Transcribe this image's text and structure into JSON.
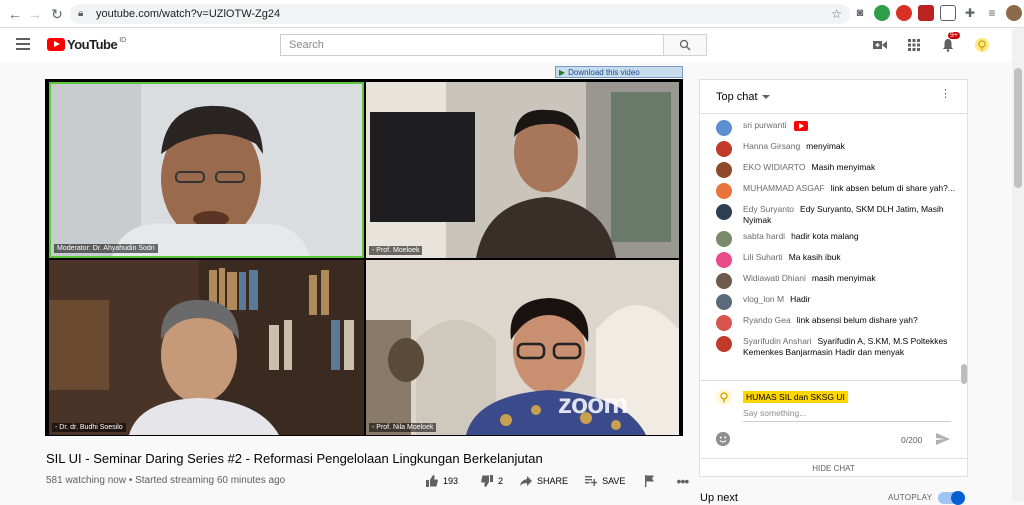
{
  "browser": {
    "url": "youtube.com/watch?v=UZlOTW-Zg24"
  },
  "header": {
    "logo_text": "YouTube",
    "country_code": "ID",
    "search_placeholder": "Search",
    "notification_count": "9+"
  },
  "video": {
    "download_label": "Download this video",
    "zoom_watermark": "zoom",
    "tiles": [
      {
        "label": "Moderator: Dr. Ahyahudin Sodri"
      },
      {
        "label": "- Prof. Moeloek"
      },
      {
        "label": "- Dr. dr. Budhi Soesilo"
      },
      {
        "label": "- Prof. Nila Moeloek"
      }
    ]
  },
  "info": {
    "title": "SIL UI - Seminar Daring Series #2 - Reformasi Pengelolaan Lingkungan Berkelanjutan",
    "meta": "581 watching now • Started streaming 60 minutes ago",
    "likes": "193",
    "dislikes": "2",
    "share_label": "SHARE",
    "save_label": "SAVE"
  },
  "chat": {
    "mode_label": "Top chat",
    "messages": [
      {
        "name": "sri purwanti",
        "text": "",
        "color": "#5b8fd1"
      },
      {
        "name": "Hanna Girsang",
        "text": "menyimak",
        "color": "#c0392b"
      },
      {
        "name": "EKO WIDIARTO",
        "text": "Masih menyimak",
        "color": "#8e4a2a"
      },
      {
        "name": "MUHAMMAD ASGAF",
        "text": "link absen belum di share yah?...",
        "color": "#e8743b"
      },
      {
        "name": "Edy Suryanto",
        "text": "Edy Suryanto, SKM DLH Jatim, Masih Nyimak",
        "color": "#2c3e50"
      },
      {
        "name": "sabta hardi",
        "text": "hadir kota malang",
        "color": "#7a8a6a"
      },
      {
        "name": "Lili Suharti",
        "text": "Ma kasih ibuk",
        "color": "#e84a8a"
      },
      {
        "name": "Widiawati Dhiani",
        "text": "masih menyimak",
        "color": "#6d5a4a"
      },
      {
        "name": "vlog_lon M",
        "text": "Hadir",
        "color": "#5a6a7a"
      },
      {
        "name": "Ryando Gea",
        "text": "link absensi belum dishare yah?",
        "color": "#d9534f"
      },
      {
        "name": "Syarifudin Anshari",
        "text": "Syarifudin A, S.KM, M.S Poltekkes Kemenkes Banjarmasin Hadir dan menyak",
        "color": "#c0392b"
      }
    ],
    "composer_name": "HUMAS SIL dan SKSG UI",
    "composer_placeholder": "Say something...",
    "char_count": "0/200",
    "hide_label": "HIDE CHAT"
  },
  "sidebar": {
    "up_next": "Up next",
    "autoplay": "AUTOPLAY"
  }
}
